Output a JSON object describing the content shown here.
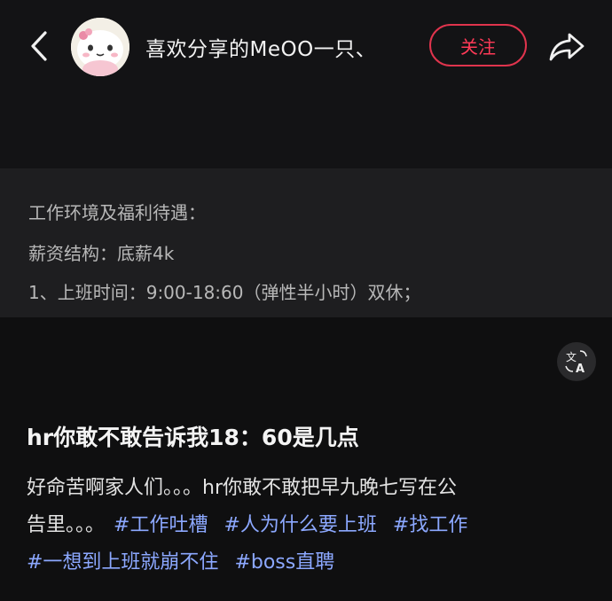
{
  "header": {
    "back_icon": "chevron-left-icon",
    "username": "喜欢分享的MeOO一只、",
    "follow_label": "关注",
    "share_icon": "share-arrow-icon",
    "accent_color": "#e0344d"
  },
  "image_text": {
    "lines": [
      "工作环境及福利待遇：",
      "薪资结构：底薪4k",
      "1、上班时间：9:00-18:60（弹性半小时）双休；"
    ]
  },
  "translate": {
    "icon": "translate-icon"
  },
  "post": {
    "title": "hr你敢不敢告诉我18：60是几点",
    "body_line1": "好命苦啊家人们。。。hr你敢不敢把早九晚七写在公",
    "body_line2": "告里。。。",
    "tags": [
      "#工作吐槽",
      "#人为什么要上班",
      "#找工作",
      "#一想到上班就崩不住",
      "#boss直聘"
    ],
    "tag_color": "#8ca8ff"
  }
}
